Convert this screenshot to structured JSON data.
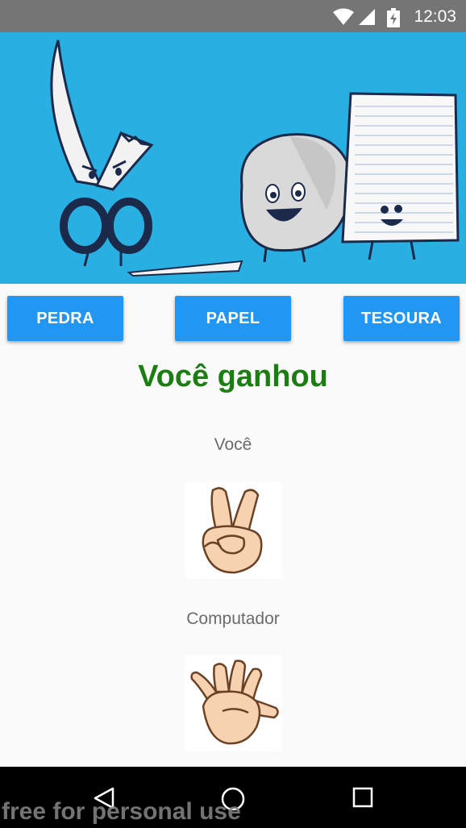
{
  "status_bar": {
    "time": "12:03",
    "icons": [
      "wifi-icon",
      "signal-icon",
      "battery-icon"
    ]
  },
  "header_image": {
    "description_icon": "rock-paper-scissors-banner",
    "background_color": "#29b0e3"
  },
  "buttons": {
    "rock": "PEDRA",
    "paper": "PAPEL",
    "scissors": "TESOURA",
    "color": "#2196f3"
  },
  "result": {
    "text": "Você ganhou",
    "color": "#1c7d12"
  },
  "player": {
    "label": "Você",
    "choice_icon": "scissors-hand-icon"
  },
  "computer": {
    "label": "Computador",
    "choice_icon": "paper-hand-icon"
  },
  "nav_bar": {
    "icons": [
      "back-icon",
      "home-icon",
      "recents-icon"
    ]
  },
  "watermark": {
    "text": "free for personal use"
  }
}
